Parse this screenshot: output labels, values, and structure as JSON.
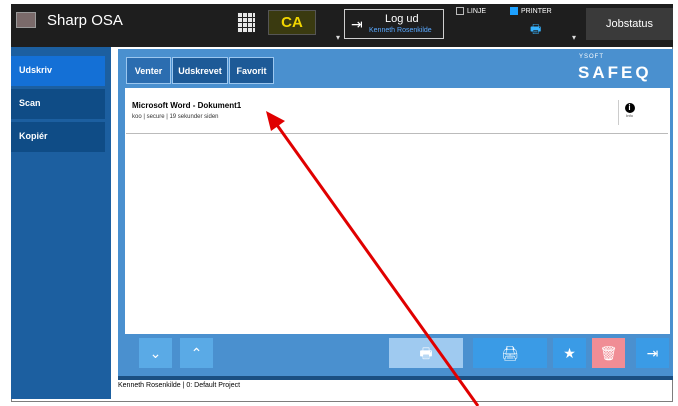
{
  "header": {
    "brand": "Sharp OSA",
    "ca_label": "CA",
    "logout_label": "Log ud",
    "logout_user": "Kenneth Rosenkilde",
    "mode_linje": "LINJE",
    "mode_printer": "PRINTER",
    "jobstatus": "Jobstatus"
  },
  "sidebar": {
    "items": [
      {
        "label": "Udskriv",
        "active": true
      },
      {
        "label": "Scan",
        "active": false
      },
      {
        "label": "Kopiér",
        "active": false
      }
    ]
  },
  "tabs": [
    {
      "label": "Venter",
      "active": true
    },
    {
      "label": "Udskrevet",
      "active": false
    },
    {
      "label": "Favorit",
      "active": false
    }
  ],
  "logo": {
    "top": "YSOFT",
    "main": "SAFEQ"
  },
  "job": {
    "title": "Microsoft Word - Dokument1",
    "meta": "koo | secure | 19 sekunder siden",
    "info_label": "Info"
  },
  "status_line": "Kenneth Rosenkilde  | 0: Default Project",
  "icons": {
    "down": "chevron-down-icon",
    "up": "chevron-up-icon",
    "print": "print-icon",
    "print_secure": "print-secure-icon",
    "favorite": "star-icon",
    "delete": "trash-icon",
    "logout": "logout-icon"
  },
  "colors": {
    "accent_blue": "#1470d6",
    "arrow": "#e00000",
    "ca_yellow": "#f1d500"
  }
}
